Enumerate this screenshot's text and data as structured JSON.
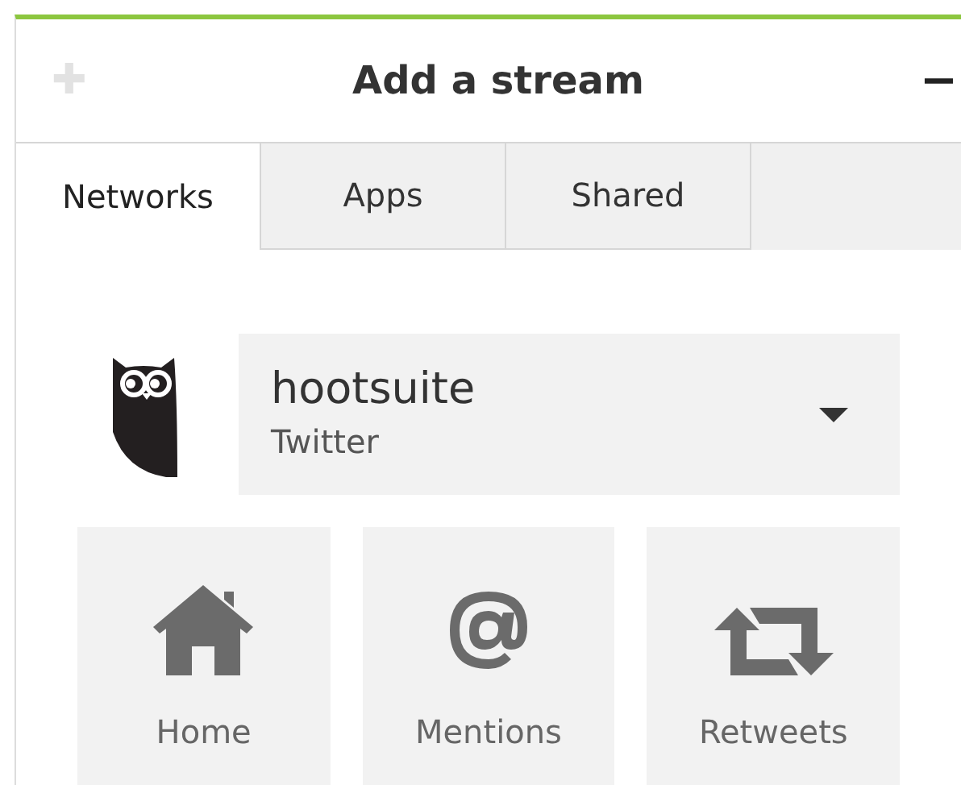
{
  "header": {
    "title": "Add a stream",
    "add_icon": "✚",
    "collapse": "−"
  },
  "tabs": [
    {
      "label": "Networks",
      "selected": true
    },
    {
      "label": "Apps",
      "selected": false
    },
    {
      "label": "Shared",
      "selected": false
    }
  ],
  "account": {
    "name": "hootsuite",
    "network": "Twitter"
  },
  "streams": [
    {
      "kind": "home",
      "label": "Home"
    },
    {
      "kind": "mentions",
      "label": "Mentions"
    },
    {
      "kind": "retweets",
      "label": "Retweets"
    }
  ]
}
